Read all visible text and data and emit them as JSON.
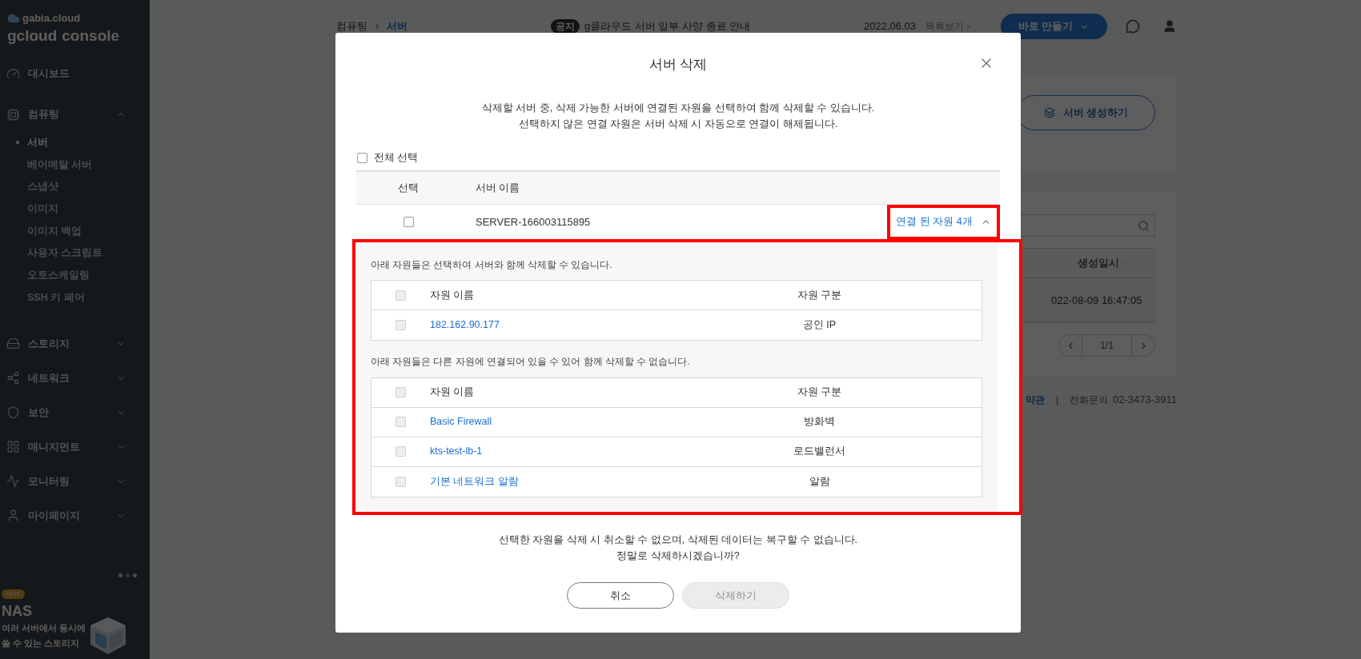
{
  "sidebar": {
    "logo_small": "gabia.cloud",
    "logo_main": "gcloud",
    "logo_accent": "console",
    "items": [
      {
        "kind": "dashboard",
        "label": "대시보드"
      },
      {
        "kind": "compute",
        "label": "컴퓨팅",
        "expanded": true,
        "children": [
          {
            "label": "서버",
            "selected": true
          },
          {
            "label": "베어메탈 서버",
            "selected": false
          },
          {
            "label": "스냅샷",
            "selected": false
          },
          {
            "label": "이미지",
            "selected": false
          },
          {
            "label": "이미지 백업",
            "selected": false
          },
          {
            "label": "사용자 스크립트",
            "selected": false
          },
          {
            "label": "오토스케일링",
            "selected": false
          },
          {
            "label": "SSH 키 페어",
            "selected": false
          }
        ]
      },
      {
        "kind": "storage",
        "label": "스토리지",
        "expanded": false
      },
      {
        "kind": "network",
        "label": "네트워크",
        "expanded": false
      },
      {
        "kind": "security",
        "label": "보안",
        "expanded": false
      },
      {
        "kind": "management",
        "label": "매니지먼트",
        "expanded": false
      },
      {
        "kind": "monitoring",
        "label": "모니터링",
        "expanded": false
      },
      {
        "kind": "mypage",
        "label": "마이페이지",
        "expanded": false
      }
    ],
    "promo": {
      "badge": "HOT",
      "title": "NAS",
      "text_lines": [
        "여러 서버에서 동시에",
        "쓸 수 있는 스토리지"
      ]
    }
  },
  "topbar": {
    "breadcrumb": [
      "컴퓨팅",
      "서버"
    ],
    "notice_badge": "공지",
    "notice": "g클라우드 서버 일부 사양 종료 안내",
    "date": "2022.06.03",
    "list_link": "목록보기",
    "create_button": "바로 만들기"
  },
  "page": {
    "create_server_button": "서버 생성하기",
    "column_header": "생성일시",
    "created_at": "022-08-09 16:47:05",
    "pagination": "1/1",
    "footer": {
      "terms": "약관",
      "separator": "|",
      "phone_label": "전화문의",
      "phone": "02-3473-3911"
    }
  },
  "dialog": {
    "title": "서버 삭제",
    "description": [
      "삭제할 서버 중, 삭제 가능한 서버에 연결된 자원을 선택하여 함께 삭제할 수 있습니다.",
      "선택하지 않은 연결 자원은 서버 삭제 시 자동으로 연결이 해제됩니다."
    ],
    "select_all": {
      "label": "전체 선택",
      "checked": false
    },
    "columns": [
      "선택",
      "서버 이름"
    ],
    "servers": [
      {
        "name": "SERVER-166003115895",
        "checked": false,
        "linked_label": "연결 된 자원 4개",
        "expanded": true,
        "highlighted": true
      }
    ],
    "panel": {
      "highlighted": true,
      "groups": [
        {
          "note": "아래 자원들은 선택하여 서버와 함께 삭제할 수 있습니다.",
          "columns": [
            "자원 이름",
            "자원 구분"
          ],
          "header_checked": false,
          "header_disabled": true,
          "rows": [
            {
              "name": "182.162.90.177",
              "type": "공인 IP",
              "checked": false,
              "disabled": true
            }
          ]
        },
        {
          "note": "아래 자원들은 다른 자원에 연결되어 있을 수 있어 함께 삭제할 수 없습니다.",
          "columns": [
            "자원 이름",
            "자원 구분"
          ],
          "header_checked": false,
          "header_disabled": true,
          "rows": [
            {
              "name": "Basic Firewall",
              "type": "방화벽",
              "checked": false,
              "disabled": true
            },
            {
              "name": "kts-test-lb-1",
              "type": "로드밸런서",
              "checked": false,
              "disabled": true
            },
            {
              "name": "기본 네트워크 알람",
              "type": "알람",
              "checked": false,
              "disabled": true
            }
          ]
        }
      ]
    },
    "warning": [
      "선택한 자원을 삭제 시 취소할 수 없으며, 삭제된 데이터는 복구할 수 없습니다.",
      "정말로 삭제하시겠습니까?"
    ],
    "buttons": [
      {
        "label": "취소",
        "disabled": false
      },
      {
        "label": "삭제하기",
        "disabled": true
      }
    ]
  }
}
